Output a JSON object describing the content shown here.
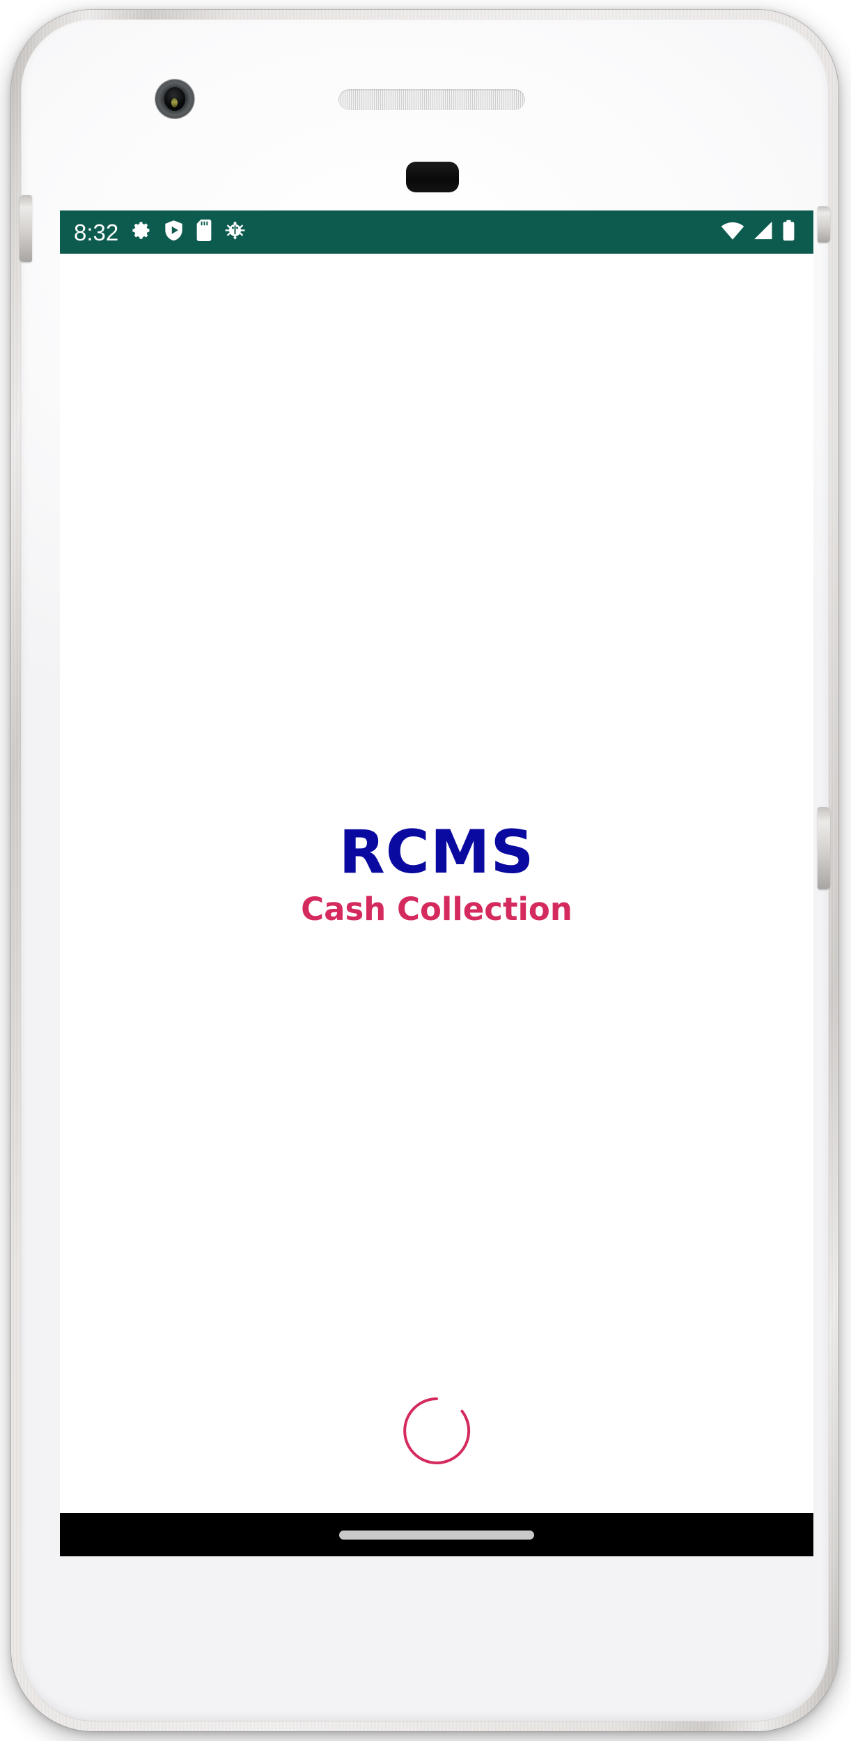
{
  "device": {
    "type": "android-phone-mockup",
    "body_color": "#f5f5f6",
    "frame_color": "#d8d5d2",
    "hardware": [
      {
        "name": "front-camera",
        "label": "Front camera"
      },
      {
        "name": "earpiece-speaker",
        "label": "Earpiece speaker"
      },
      {
        "name": "proximity-sensor",
        "label": "Proximity sensor"
      },
      {
        "name": "volume-button-left",
        "label": "Volume button"
      },
      {
        "name": "power-button-right",
        "label": "Power button"
      },
      {
        "name": "volume-button-right",
        "label": "Volume rocker"
      }
    ]
  },
  "status_bar": {
    "background": "#0C5B4E",
    "foreground": "#ffffff",
    "clock": "8:32",
    "left_icons": [
      {
        "name": "settings-gear-icon",
        "label": "Settings"
      },
      {
        "name": "play-protect-shield-icon",
        "label": "Play Protect"
      },
      {
        "name": "sd-card-icon",
        "label": "SD card"
      },
      {
        "name": "debug-bug-icon",
        "label": "USB debugging"
      }
    ],
    "right_icons": [
      {
        "name": "wifi-icon",
        "label": "Wi-Fi"
      },
      {
        "name": "cellular-signal-icon",
        "label": "Mobile signal"
      },
      {
        "name": "battery-icon",
        "label": "Battery"
      }
    ]
  },
  "app": {
    "screen_name": "splash-screen",
    "background": "#ffffff",
    "title": "RCMS",
    "title_color": "#0A0AA0",
    "subtitle": "Cash Collection",
    "subtitle_color": "#D42A5E",
    "loading": {
      "name": "loading-spinner",
      "color": "#D42A5E",
      "visible": true
    }
  },
  "nav_bar": {
    "background": "#000000",
    "gesture_pill_color": "#c9c9c9",
    "mode": "gesture-navigation"
  }
}
